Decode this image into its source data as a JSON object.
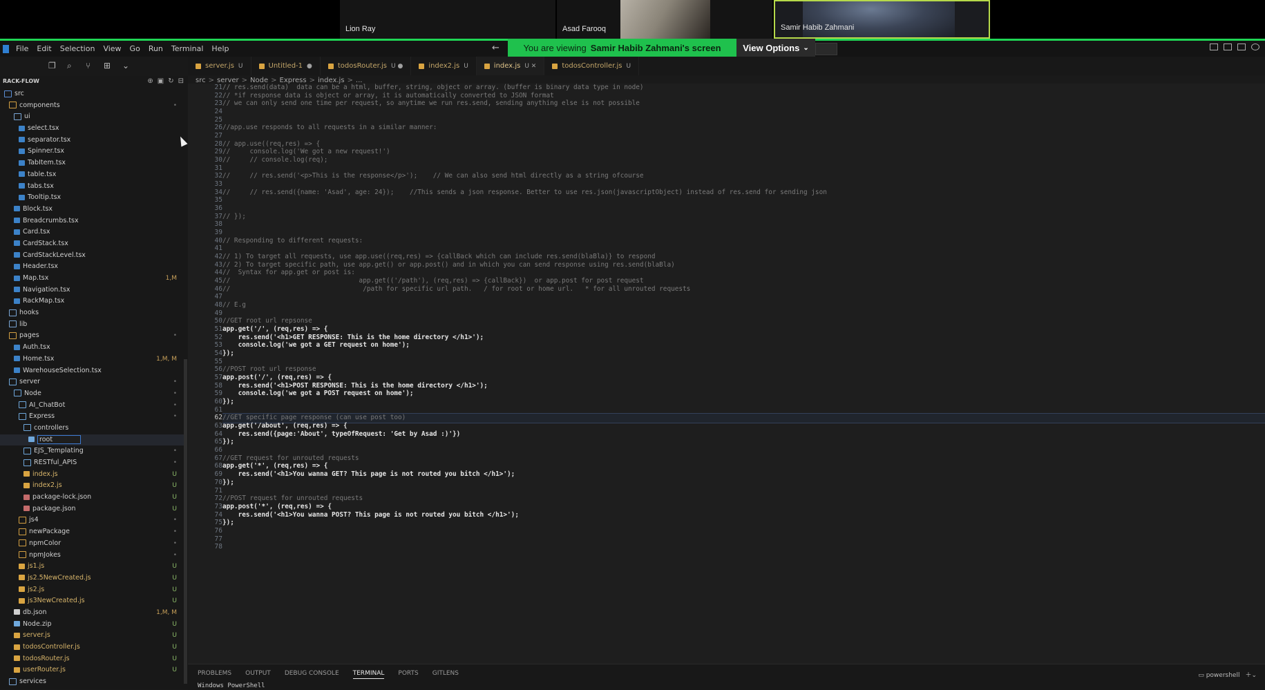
{
  "meeting": {
    "participants": [
      "Lion Ray",
      "Asad Farooq",
      "Samir Habib Zahmani"
    ],
    "banner_prefix": "You are viewing",
    "banner_name": "Samir Habib Zahmani's screen",
    "view_options": "View Options"
  },
  "menu": [
    "File",
    "Edit",
    "Selection",
    "View",
    "Go",
    "Run",
    "Terminal",
    "Help"
  ],
  "explorer": {
    "title": "RACK-FLOW",
    "items": [
      {
        "label": "src",
        "badge": "",
        "depth": 0,
        "kind": "folder",
        "color": "#5b8fd6"
      },
      {
        "label": "components",
        "badge": "•",
        "depth": 1,
        "kind": "folder",
        "color": "#d5a042"
      },
      {
        "label": "ui",
        "badge": "",
        "depth": 2,
        "kind": "folder",
        "color": "#7aa6d6"
      },
      {
        "label": "select.tsx",
        "badge": "",
        "depth": 3,
        "kind": "file",
        "color": "#3c82c8"
      },
      {
        "label": "separator.tsx",
        "badge": "",
        "depth": 3,
        "kind": "file",
        "color": "#3c82c8"
      },
      {
        "label": "Spinner.tsx",
        "badge": "",
        "depth": 3,
        "kind": "file",
        "color": "#3c82c8"
      },
      {
        "label": "TabItem.tsx",
        "badge": "",
        "depth": 3,
        "kind": "file",
        "color": "#3c82c8"
      },
      {
        "label": "table.tsx",
        "badge": "",
        "depth": 3,
        "kind": "file",
        "color": "#3c82c8"
      },
      {
        "label": "tabs.tsx",
        "badge": "",
        "depth": 3,
        "kind": "file",
        "color": "#3c82c8"
      },
      {
        "label": "Tooltip.tsx",
        "badge": "",
        "depth": 3,
        "kind": "file",
        "color": "#3c82c8"
      },
      {
        "label": "Block.tsx",
        "badge": "",
        "depth": 2,
        "kind": "file",
        "color": "#3c82c8"
      },
      {
        "label": "Breadcrumbs.tsx",
        "badge": "",
        "depth": 2,
        "kind": "file",
        "color": "#3c82c8"
      },
      {
        "label": "Card.tsx",
        "badge": "",
        "depth": 2,
        "kind": "file",
        "color": "#3c82c8"
      },
      {
        "label": "CardStack.tsx",
        "badge": "",
        "depth": 2,
        "kind": "file",
        "color": "#3c82c8"
      },
      {
        "label": "CardStackLevel.tsx",
        "badge": "",
        "depth": 2,
        "kind": "file",
        "color": "#3c82c8"
      },
      {
        "label": "Header.tsx",
        "badge": "",
        "depth": 2,
        "kind": "file",
        "color": "#3c82c8"
      },
      {
        "label": "Map.tsx",
        "badge": "1,M",
        "depth": 2,
        "kind": "file",
        "color": "#3c82c8"
      },
      {
        "label": "Navigation.tsx",
        "badge": "",
        "depth": 2,
        "kind": "file",
        "color": "#3c82c8"
      },
      {
        "label": "RackMap.tsx",
        "badge": "",
        "depth": 2,
        "kind": "file",
        "color": "#3c82c8"
      },
      {
        "label": "hooks",
        "badge": "",
        "depth": 1,
        "kind": "folder",
        "color": "#7aa6d6"
      },
      {
        "label": "lib",
        "badge": "",
        "depth": 1,
        "kind": "folder",
        "color": "#7aa6d6"
      },
      {
        "label": "pages",
        "badge": "•",
        "depth": 1,
        "kind": "folder",
        "color": "#d5a042"
      },
      {
        "label": "Auth.tsx",
        "badge": "",
        "depth": 2,
        "kind": "file",
        "color": "#3c82c8"
      },
      {
        "label": "Home.tsx",
        "badge": "1,M, M",
        "depth": 2,
        "kind": "file",
        "color": "#3c82c8"
      },
      {
        "label": "WarehouseSelection.tsx",
        "badge": "",
        "depth": 2,
        "kind": "file",
        "color": "#3c82c8"
      },
      {
        "label": "server",
        "badge": "•",
        "depth": 1,
        "kind": "folder",
        "color": "#6fa8dc"
      },
      {
        "label": "Node",
        "badge": "•",
        "depth": 2,
        "kind": "folder",
        "color": "#6fa8dc"
      },
      {
        "label": "AI_ChatBot",
        "badge": "•",
        "depth": 3,
        "kind": "folder",
        "color": "#6fa8dc"
      },
      {
        "label": "Express",
        "badge": "•",
        "depth": 3,
        "kind": "folder",
        "color": "#6fa8dc"
      },
      {
        "label": "controllers",
        "badge": "",
        "depth": 4,
        "kind": "folder",
        "color": "#6fa8dc"
      },
      {
        "label": "root",
        "badge": "",
        "depth": 5,
        "kind": "file",
        "color": "#6fa8dc",
        "selected": true
      },
      {
        "label": "EJS_Templating",
        "badge": "•",
        "depth": 4,
        "kind": "folder",
        "color": "#6fa8dc"
      },
      {
        "label": "RESTful_APIS",
        "badge": "•",
        "depth": 4,
        "kind": "folder",
        "color": "#6fa8dc"
      },
      {
        "label": "index.js",
        "badge": "U",
        "depth": 4,
        "kind": "file",
        "color": "#d9a441"
      },
      {
        "label": "index2.js",
        "badge": "U",
        "depth": 4,
        "kind": "file",
        "color": "#d9a441"
      },
      {
        "label": "package-lock.json",
        "badge": "U",
        "depth": 4,
        "kind": "file",
        "color": "#c46b6b"
      },
      {
        "label": "package.json",
        "badge": "U",
        "depth": 4,
        "kind": "file",
        "color": "#c46b6b"
      },
      {
        "label": "js4",
        "badge": "•",
        "depth": 3,
        "kind": "folder",
        "color": "#d5a042"
      },
      {
        "label": "newPackage",
        "badge": "•",
        "depth": 3,
        "kind": "folder",
        "color": "#d5a042"
      },
      {
        "label": "npmColor",
        "badge": "•",
        "depth": 3,
        "kind": "folder",
        "color": "#d5a042"
      },
      {
        "label": "npmJokes",
        "badge": "•",
        "depth": 3,
        "kind": "folder",
        "color": "#d5a042"
      },
      {
        "label": "js1.js",
        "badge": "U",
        "depth": 3,
        "kind": "file",
        "color": "#d9a441"
      },
      {
        "label": "js2.5NewCreated.js",
        "badge": "U",
        "depth": 3,
        "kind": "file",
        "color": "#d9a441"
      },
      {
        "label": "js2.js",
        "badge": "U",
        "depth": 3,
        "kind": "file",
        "color": "#d9a441"
      },
      {
        "label": "js3NewCreated.js",
        "badge": "U",
        "depth": 3,
        "kind": "file",
        "color": "#d9a441"
      },
      {
        "label": "db.json",
        "badge": "1,M, M",
        "depth": 2,
        "kind": "file",
        "color": "#cfcfcf"
      },
      {
        "label": "Node.zip",
        "badge": "U",
        "depth": 2,
        "kind": "file",
        "color": "#6fa8dc"
      },
      {
        "label": "server.js",
        "badge": "U",
        "depth": 2,
        "kind": "file",
        "color": "#d9a441"
      },
      {
        "label": "todosController.js",
        "badge": "U",
        "depth": 2,
        "kind": "file",
        "color": "#d9a441"
      },
      {
        "label": "todosRouter.js",
        "badge": "U",
        "depth": 2,
        "kind": "file",
        "color": "#d9a441"
      },
      {
        "label": "userRouter.js",
        "badge": "U",
        "depth": 2,
        "kind": "file",
        "color": "#d9a441"
      },
      {
        "label": "services",
        "badge": "",
        "depth": 1,
        "kind": "folder",
        "color": "#7aa6d6"
      }
    ]
  },
  "tabs": [
    {
      "label": "server.js",
      "status": "U"
    },
    {
      "label": "Untitled-1",
      "status": "●"
    },
    {
      "label": "todosRouter.js",
      "status": "U ●"
    },
    {
      "label": "index2.js",
      "status": "U"
    },
    {
      "label": "index.js",
      "status": "U ✕",
      "active": true
    },
    {
      "label": "todosController.js",
      "status": "U"
    }
  ],
  "breadcrumb": [
    "src",
    "server",
    "Node",
    "Express",
    "index.js",
    "..."
  ],
  "editor": {
    "current_line": 62,
    "lines": [
      {
        "n": "21",
        "t": "// res.send(data)  data can be a html, buffer, string, object or array. (buffer is binary data type in node)",
        "c": "cm"
      },
      {
        "n": "22",
        "t": "// *if response data is object or array, it is automatically converted to JSON format",
        "c": "cm"
      },
      {
        "n": "23",
        "t": "// we can only send one time per request, so anytime we run res.send, sending anything else is not possible",
        "c": "cm"
      },
      {
        "n": "24",
        "t": "",
        "c": "cm"
      },
      {
        "n": "25",
        "t": "",
        "c": "cm"
      },
      {
        "n": "26",
        "t": "//app.use responds to all requests in a similar manner:",
        "c": "cm"
      },
      {
        "n": "27",
        "t": "",
        "c": "cm"
      },
      {
        "n": "28",
        "t": "// app.use((req,res) => {",
        "c": "cm"
      },
      {
        "n": "29",
        "t": "//     console.log('We got a new request!')",
        "c": "cm"
      },
      {
        "n": "30",
        "t": "//     // console.log(req);",
        "c": "cm"
      },
      {
        "n": "31",
        "t": "",
        "c": "cm"
      },
      {
        "n": "32",
        "t": "//     // res.send('<p>This is the response</p>');    // We can also send html directly as a string ofcourse",
        "c": "cm"
      },
      {
        "n": "33",
        "t": "",
        "c": "cm"
      },
      {
        "n": "34",
        "t": "//     // res.send({name: 'Asad', age: 24});    //This sends a json response. Better to use res.json(javascriptObject) instead of res.send for sending json",
        "c": "cm"
      },
      {
        "n": "35",
        "t": "",
        "c": "cm"
      },
      {
        "n": "36",
        "t": "",
        "c": "cm"
      },
      {
        "n": "37",
        "t": "// });",
        "c": "cm"
      },
      {
        "n": "38",
        "t": "",
        "c": "cm"
      },
      {
        "n": "39",
        "t": "",
        "c": "cm"
      },
      {
        "n": "40",
        "t": "// Responding to different requests:",
        "c": "cm"
      },
      {
        "n": "41",
        "t": "",
        "c": "cm"
      },
      {
        "n": "42",
        "t": "// 1) To target all requests, use app.use((req,res) => {callBack which can include res.send(blaBla)} to respond",
        "c": "cm"
      },
      {
        "n": "43",
        "t": "// 2) To target specific path, use app.get() or app.post() and in which you can send response using res.send(blaBla)",
        "c": "cm"
      },
      {
        "n": "44",
        "t": "//  Syntax for app.get or post is:",
        "c": "cm"
      },
      {
        "n": "45",
        "t": "//                                 app.get(('/path'), (req,res) => {callBack})  or app.post for post request",
        "c": "cm"
      },
      {
        "n": "46",
        "t": "//                                  /path for specific url path.   / for root or home url.   * for all unrouted requests",
        "c": "cm"
      },
      {
        "n": "47",
        "t": "",
        "c": "cm"
      },
      {
        "n": "48",
        "t": "// E.g",
        "c": "cm"
      },
      {
        "n": "49",
        "t": "",
        "c": "cm"
      },
      {
        "n": "50",
        "t": "//GET root url repsonse",
        "c": "cm"
      },
      {
        "n": "51",
        "t": "app.get('/', (req,res) => {",
        "c": "k"
      },
      {
        "n": "52",
        "t": "    res.send('<h1>GET RESPONSE: This is the home directory </h1>');",
        "c": "k"
      },
      {
        "n": "53",
        "t": "    console.log('we got a GET request on home');",
        "c": "k"
      },
      {
        "n": "54",
        "t": "});",
        "c": "k"
      },
      {
        "n": "55",
        "t": "",
        "c": "k"
      },
      {
        "n": "56",
        "t": "//POST root url response",
        "c": "cm"
      },
      {
        "n": "57",
        "t": "app.post('/', (req,res) => {",
        "c": "k"
      },
      {
        "n": "58",
        "t": "    res.send('<h1>POST RESPONSE: This is the home directory </h1>');",
        "c": "k"
      },
      {
        "n": "59",
        "t": "    console.log('we got a POST request on home');",
        "c": "k"
      },
      {
        "n": "60",
        "t": "});",
        "c": "k"
      },
      {
        "n": "61",
        "t": "",
        "c": "k"
      },
      {
        "n": "62",
        "t": "//GET specific page response (can use post too)",
        "c": "cm"
      },
      {
        "n": "63",
        "t": "app.get('/about', (req,res) => {",
        "c": "k"
      },
      {
        "n": "64",
        "t": "    res.send({page:'About', typeOfRequest: 'Get by Asad :)'})",
        "c": "k"
      },
      {
        "n": "65",
        "t": "});",
        "c": "k"
      },
      {
        "n": "66",
        "t": "",
        "c": "k"
      },
      {
        "n": "67",
        "t": "//GET request for unrouted requests",
        "c": "cm"
      },
      {
        "n": "68",
        "t": "app.get('*', (req,res) => {",
        "c": "k"
      },
      {
        "n": "69",
        "t": "    res.send('<h1>You wanna GET? This page is not routed you bitch </h1>');",
        "c": "k"
      },
      {
        "n": "70",
        "t": "});",
        "c": "k"
      },
      {
        "n": "71",
        "t": "",
        "c": "k"
      },
      {
        "n": "72",
        "t": "//POST request for unrouted requests",
        "c": "cm"
      },
      {
        "n": "73",
        "t": "app.post('*', (req,res) => {",
        "c": "k"
      },
      {
        "n": "74",
        "t": "    res.send('<h1>You wanna POST? This page is not routed you bitch </h1>');",
        "c": "k"
      },
      {
        "n": "75",
        "t": "});",
        "c": "k"
      },
      {
        "n": "76",
        "t": "",
        "c": "k"
      },
      {
        "n": "77",
        "t": "",
        "c": "k"
      },
      {
        "n": "78",
        "t": "",
        "c": "k"
      }
    ]
  },
  "panel": {
    "tabs": [
      "PROBLEMS",
      "OUTPUT",
      "DEBUG CONSOLE",
      "TERMINAL",
      "PORTS",
      "GITLENS"
    ],
    "active_tab": "TERMINAL",
    "shell": "powershell",
    "terminal_text": "Windows PowerShell"
  }
}
